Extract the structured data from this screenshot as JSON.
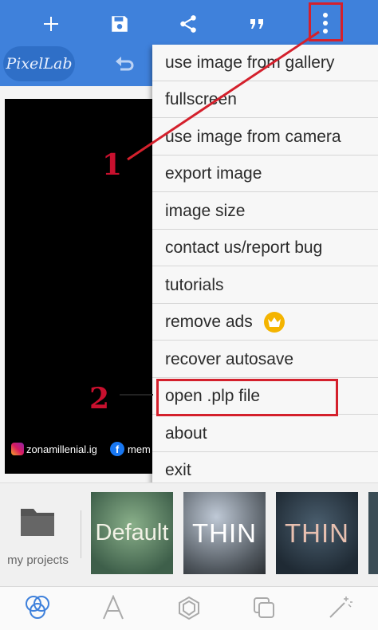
{
  "app": {
    "logo_text": "PixelLab",
    "accent": "#3f81db"
  },
  "toolbar": {
    "icons": [
      "add-icon",
      "save-icon",
      "share-icon",
      "quote-icon",
      "more-vert-icon"
    ],
    "undo_icon": "undo-icon"
  },
  "canvas": {
    "watermark_instagram": "zonamillenial.ig",
    "watermark_facebook": "mem"
  },
  "menu": {
    "items": [
      {
        "label": "use image from gallery"
      },
      {
        "label": "fullscreen"
      },
      {
        "label": "use image from camera"
      },
      {
        "label": "export image"
      },
      {
        "label": "image size"
      },
      {
        "label": "contact us/report bug"
      },
      {
        "label": "tutorials"
      },
      {
        "label": "remove ads"
      },
      {
        "label": "recover autosave"
      },
      {
        "label": "open .plp file"
      },
      {
        "label": "about"
      },
      {
        "label": "exit"
      }
    ]
  },
  "annotations": {
    "step1": "1",
    "step2": "2",
    "color": "#d4202c"
  },
  "projects": {
    "label": "my projects",
    "tiles": [
      {
        "text": "Default"
      },
      {
        "text": "THIN"
      },
      {
        "text": "THIN"
      }
    ]
  },
  "bottom_nav": {
    "icons": [
      "layers-icon",
      "text-icon",
      "shape-icon",
      "duplicate-icon",
      "magic-wand-icon"
    ],
    "active_color": "#3f81db"
  }
}
